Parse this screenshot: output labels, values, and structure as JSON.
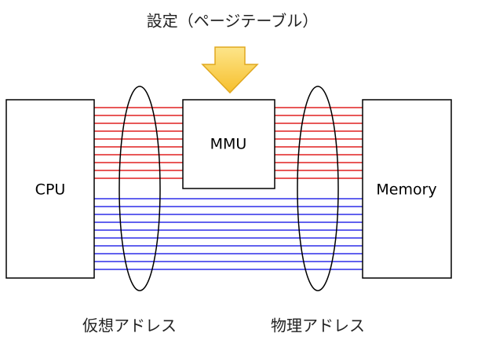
{
  "title": "設定（ページテーブル）",
  "components": {
    "cpu": "CPU",
    "mmu": "MMU",
    "memory": "Memory"
  },
  "captions": {
    "virtual_address": "仮想アドレス",
    "physical_address": "物理アドレス"
  },
  "colors": {
    "virtual_bus": "#e02020",
    "physical_bus": "#2e2ee8",
    "arrow_fill": "#f9c93c",
    "arrow_stroke": "#e0a820"
  },
  "icons": {
    "settings_arrow": "down-arrow-icon"
  }
}
